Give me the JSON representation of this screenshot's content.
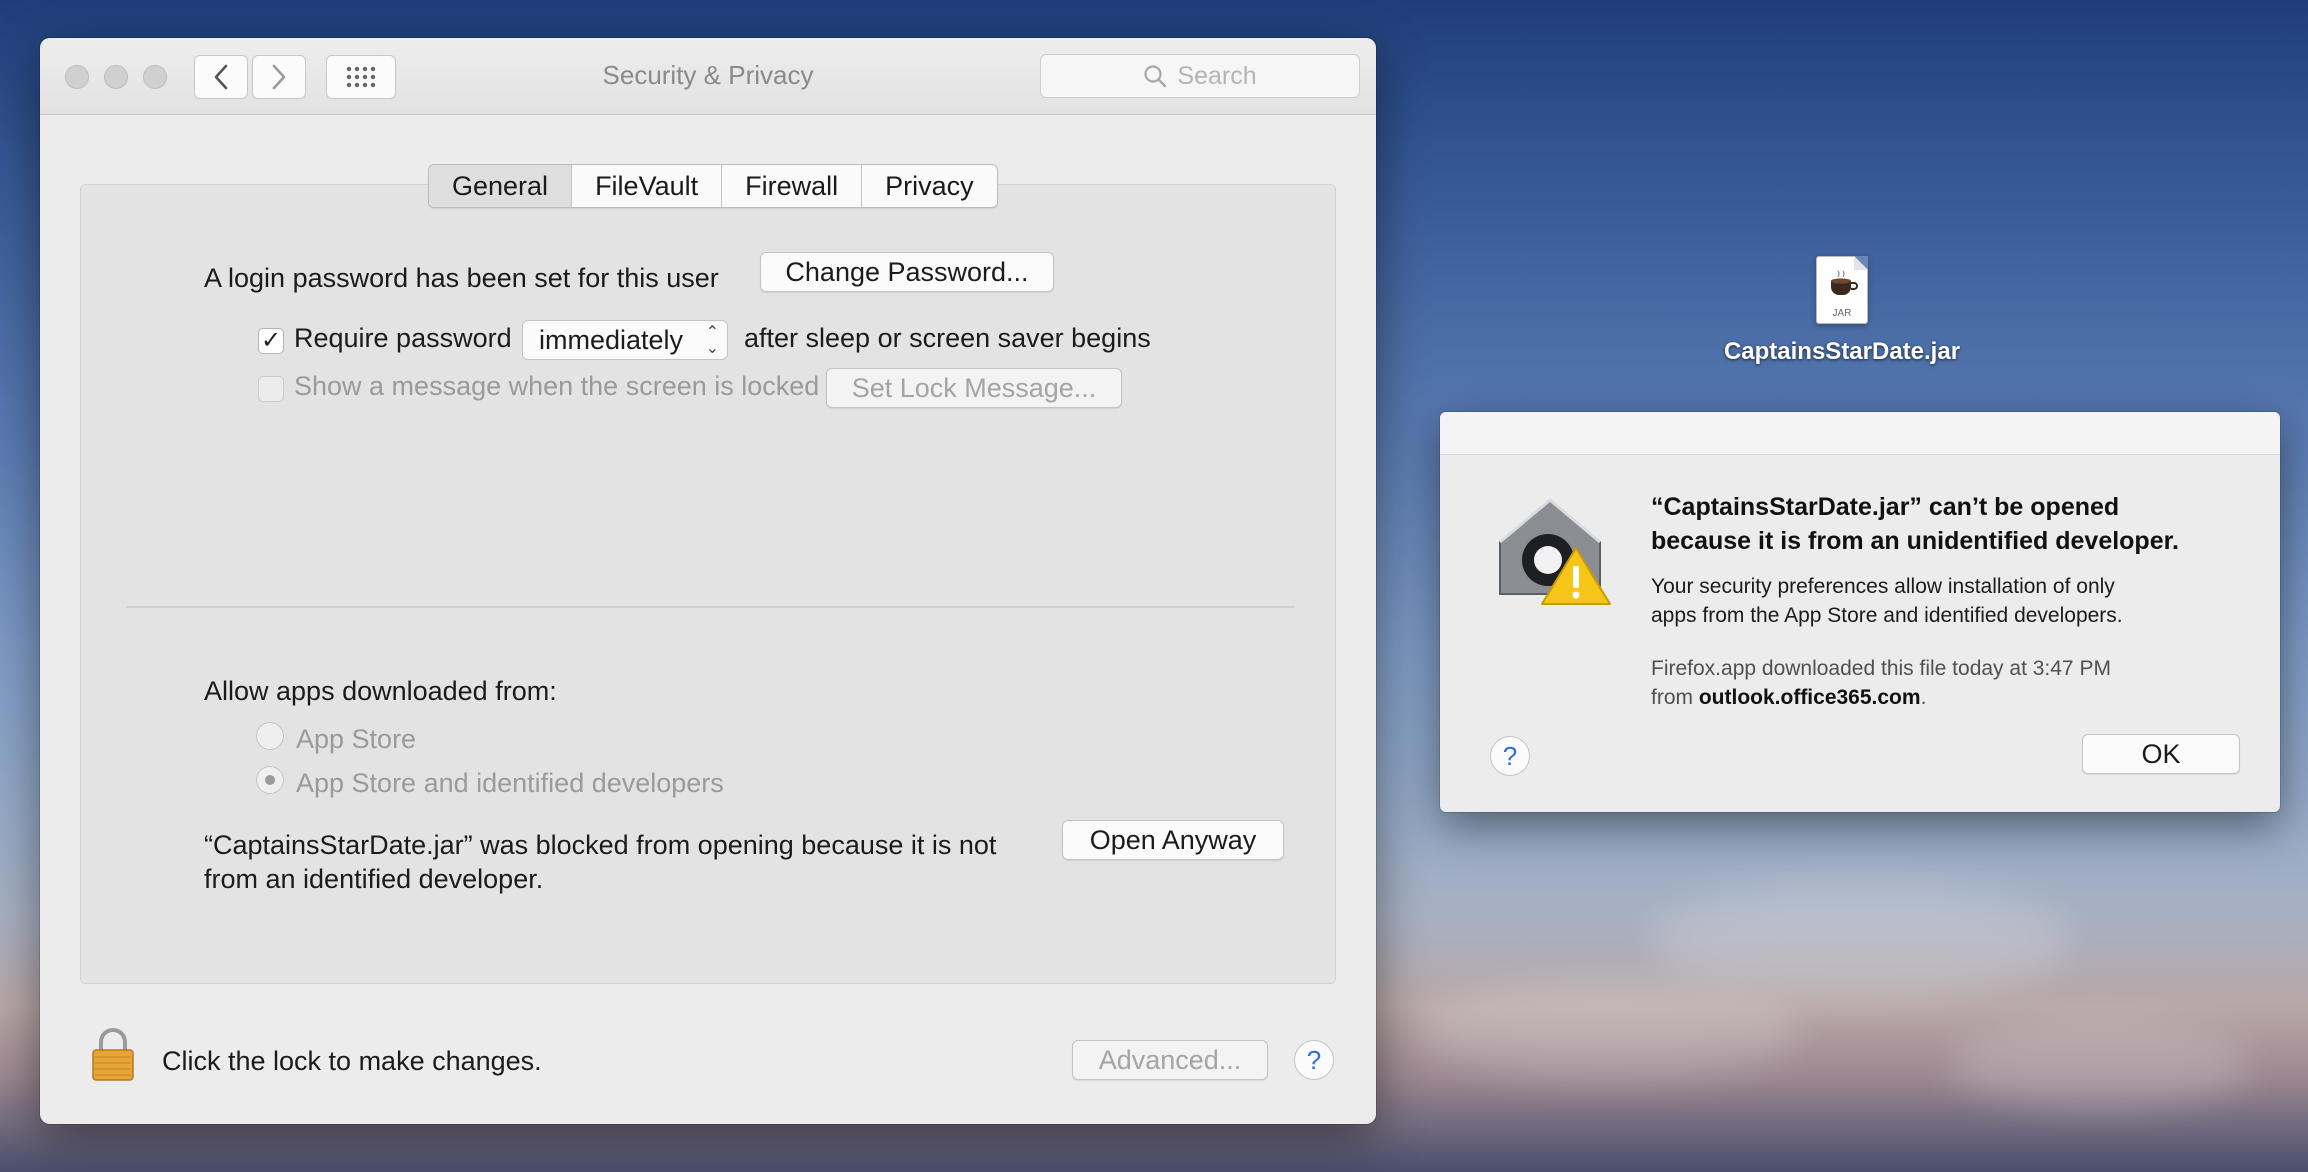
{
  "window": {
    "title": "Security & Privacy",
    "search_placeholder": "Search",
    "tabs": [
      "General",
      "FileVault",
      "Firewall",
      "Privacy"
    ]
  },
  "general": {
    "login_text": "A login password has been set for this user",
    "change_password_button": "Change Password...",
    "require_password_label": "Require password",
    "require_password_checked": true,
    "require_password_value": "immediately",
    "after_sleep_text": "after sleep or screen saver begins",
    "show_message_label": "Show a message when the screen is locked",
    "show_message_checked": false,
    "set_lock_message_button": "Set Lock Message...",
    "allow_apps_label": "Allow apps downloaded from:",
    "options": [
      "App Store",
      "App Store and identified developers"
    ],
    "selected_option": "App Store and identified developers",
    "blocked_line1": "“CaptainsStarDate.jar” was blocked from opening because it is not",
    "blocked_line2": "from an identified developer.",
    "open_anyway_button": "Open Anyway"
  },
  "footer": {
    "lock_text": "Click the lock to make changes.",
    "advanced_button": "Advanced...",
    "help_label": "?"
  },
  "desktop_file": {
    "name": "CaptainsStarDate.jar",
    "icon_text": "JAR"
  },
  "alert": {
    "title_line1": "“CaptainsStarDate.jar” can’t be opened",
    "title_line2": "because it is from an unidentified developer.",
    "body_line1": "Your security preferences allow installation of only",
    "body_line2": "apps from the App Store and identified developers.",
    "info_line1": "Firefox.app downloaded this file today at 3:47 PM",
    "info_from": "from",
    "info_domain": "outlook.office365.com",
    "info_period": ".",
    "ok_button": "OK",
    "help_label": "?"
  },
  "colors": {
    "accent": "#2a6fd6",
    "window_bg": "#ececec",
    "panel_bg": "#e3e3e3",
    "warning_yellow": "#f5c518",
    "lock_gold": "#e6a536"
  }
}
